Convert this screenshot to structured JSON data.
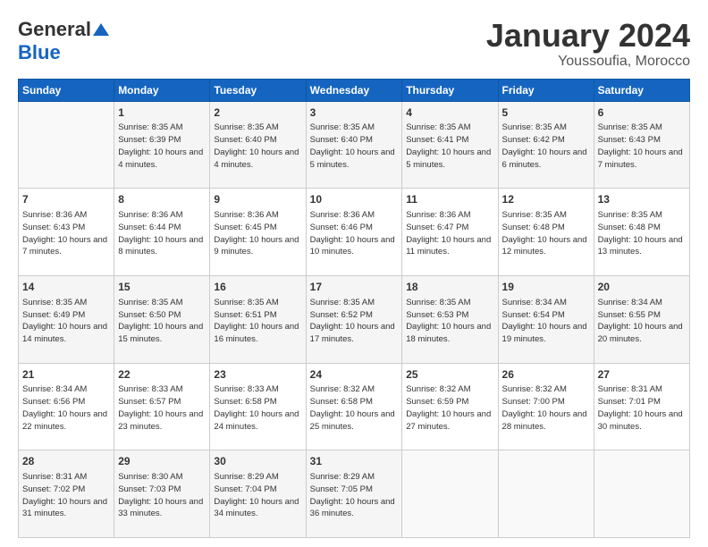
{
  "logo": {
    "general": "General",
    "blue": "Blue"
  },
  "title": "January 2024",
  "location": "Youssoufia, Morocco",
  "days_of_week": [
    "Sunday",
    "Monday",
    "Tuesday",
    "Wednesday",
    "Thursday",
    "Friday",
    "Saturday"
  ],
  "weeks": [
    [
      {
        "day": "",
        "sunrise": "",
        "sunset": "",
        "daylight": "",
        "empty": true
      },
      {
        "day": "1",
        "sunrise": "Sunrise: 8:35 AM",
        "sunset": "Sunset: 6:39 PM",
        "daylight": "Daylight: 10 hours and 4 minutes."
      },
      {
        "day": "2",
        "sunrise": "Sunrise: 8:35 AM",
        "sunset": "Sunset: 6:40 PM",
        "daylight": "Daylight: 10 hours and 4 minutes."
      },
      {
        "day": "3",
        "sunrise": "Sunrise: 8:35 AM",
        "sunset": "Sunset: 6:40 PM",
        "daylight": "Daylight: 10 hours and 5 minutes."
      },
      {
        "day": "4",
        "sunrise": "Sunrise: 8:35 AM",
        "sunset": "Sunset: 6:41 PM",
        "daylight": "Daylight: 10 hours and 5 minutes."
      },
      {
        "day": "5",
        "sunrise": "Sunrise: 8:35 AM",
        "sunset": "Sunset: 6:42 PM",
        "daylight": "Daylight: 10 hours and 6 minutes."
      },
      {
        "day": "6",
        "sunrise": "Sunrise: 8:35 AM",
        "sunset": "Sunset: 6:43 PM",
        "daylight": "Daylight: 10 hours and 7 minutes."
      }
    ],
    [
      {
        "day": "7",
        "sunrise": "Sunrise: 8:36 AM",
        "sunset": "Sunset: 6:43 PM",
        "daylight": "Daylight: 10 hours and 7 minutes."
      },
      {
        "day": "8",
        "sunrise": "Sunrise: 8:36 AM",
        "sunset": "Sunset: 6:44 PM",
        "daylight": "Daylight: 10 hours and 8 minutes."
      },
      {
        "day": "9",
        "sunrise": "Sunrise: 8:36 AM",
        "sunset": "Sunset: 6:45 PM",
        "daylight": "Daylight: 10 hours and 9 minutes."
      },
      {
        "day": "10",
        "sunrise": "Sunrise: 8:36 AM",
        "sunset": "Sunset: 6:46 PM",
        "daylight": "Daylight: 10 hours and 10 minutes."
      },
      {
        "day": "11",
        "sunrise": "Sunrise: 8:36 AM",
        "sunset": "Sunset: 6:47 PM",
        "daylight": "Daylight: 10 hours and 11 minutes."
      },
      {
        "day": "12",
        "sunrise": "Sunrise: 8:35 AM",
        "sunset": "Sunset: 6:48 PM",
        "daylight": "Daylight: 10 hours and 12 minutes."
      },
      {
        "day": "13",
        "sunrise": "Sunrise: 8:35 AM",
        "sunset": "Sunset: 6:48 PM",
        "daylight": "Daylight: 10 hours and 13 minutes."
      }
    ],
    [
      {
        "day": "14",
        "sunrise": "Sunrise: 8:35 AM",
        "sunset": "Sunset: 6:49 PM",
        "daylight": "Daylight: 10 hours and 14 minutes."
      },
      {
        "day": "15",
        "sunrise": "Sunrise: 8:35 AM",
        "sunset": "Sunset: 6:50 PM",
        "daylight": "Daylight: 10 hours and 15 minutes."
      },
      {
        "day": "16",
        "sunrise": "Sunrise: 8:35 AM",
        "sunset": "Sunset: 6:51 PM",
        "daylight": "Daylight: 10 hours and 16 minutes."
      },
      {
        "day": "17",
        "sunrise": "Sunrise: 8:35 AM",
        "sunset": "Sunset: 6:52 PM",
        "daylight": "Daylight: 10 hours and 17 minutes."
      },
      {
        "day": "18",
        "sunrise": "Sunrise: 8:35 AM",
        "sunset": "Sunset: 6:53 PM",
        "daylight": "Daylight: 10 hours and 18 minutes."
      },
      {
        "day": "19",
        "sunrise": "Sunrise: 8:34 AM",
        "sunset": "Sunset: 6:54 PM",
        "daylight": "Daylight: 10 hours and 19 minutes."
      },
      {
        "day": "20",
        "sunrise": "Sunrise: 8:34 AM",
        "sunset": "Sunset: 6:55 PM",
        "daylight": "Daylight: 10 hours and 20 minutes."
      }
    ],
    [
      {
        "day": "21",
        "sunrise": "Sunrise: 8:34 AM",
        "sunset": "Sunset: 6:56 PM",
        "daylight": "Daylight: 10 hours and 22 minutes."
      },
      {
        "day": "22",
        "sunrise": "Sunrise: 8:33 AM",
        "sunset": "Sunset: 6:57 PM",
        "daylight": "Daylight: 10 hours and 23 minutes."
      },
      {
        "day": "23",
        "sunrise": "Sunrise: 8:33 AM",
        "sunset": "Sunset: 6:58 PM",
        "daylight": "Daylight: 10 hours and 24 minutes."
      },
      {
        "day": "24",
        "sunrise": "Sunrise: 8:32 AM",
        "sunset": "Sunset: 6:58 PM",
        "daylight": "Daylight: 10 hours and 25 minutes."
      },
      {
        "day": "25",
        "sunrise": "Sunrise: 8:32 AM",
        "sunset": "Sunset: 6:59 PM",
        "daylight": "Daylight: 10 hours and 27 minutes."
      },
      {
        "day": "26",
        "sunrise": "Sunrise: 8:32 AM",
        "sunset": "Sunset: 7:00 PM",
        "daylight": "Daylight: 10 hours and 28 minutes."
      },
      {
        "day": "27",
        "sunrise": "Sunrise: 8:31 AM",
        "sunset": "Sunset: 7:01 PM",
        "daylight": "Daylight: 10 hours and 30 minutes."
      }
    ],
    [
      {
        "day": "28",
        "sunrise": "Sunrise: 8:31 AM",
        "sunset": "Sunset: 7:02 PM",
        "daylight": "Daylight: 10 hours and 31 minutes."
      },
      {
        "day": "29",
        "sunrise": "Sunrise: 8:30 AM",
        "sunset": "Sunset: 7:03 PM",
        "daylight": "Daylight: 10 hours and 33 minutes."
      },
      {
        "day": "30",
        "sunrise": "Sunrise: 8:29 AM",
        "sunset": "Sunset: 7:04 PM",
        "daylight": "Daylight: 10 hours and 34 minutes."
      },
      {
        "day": "31",
        "sunrise": "Sunrise: 8:29 AM",
        "sunset": "Sunset: 7:05 PM",
        "daylight": "Daylight: 10 hours and 36 minutes."
      },
      {
        "day": "",
        "sunrise": "",
        "sunset": "",
        "daylight": "",
        "empty": true
      },
      {
        "day": "",
        "sunrise": "",
        "sunset": "",
        "daylight": "",
        "empty": true
      },
      {
        "day": "",
        "sunrise": "",
        "sunset": "",
        "daylight": "",
        "empty": true
      }
    ]
  ]
}
